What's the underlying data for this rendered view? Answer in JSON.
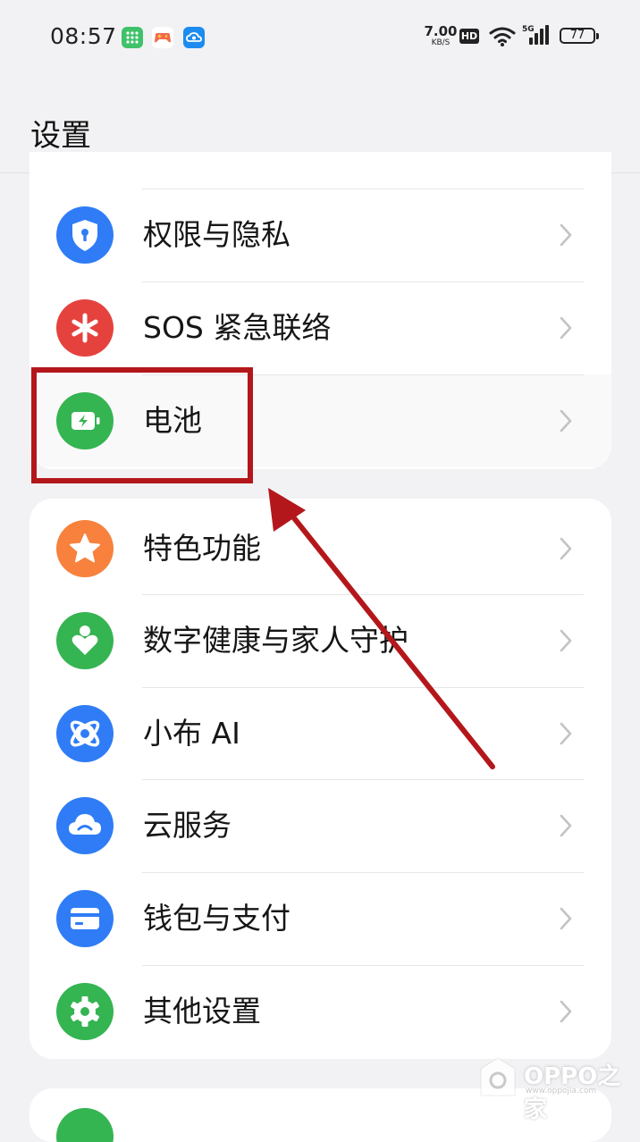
{
  "status_bar": {
    "time": "08:57",
    "net_speed_value": "7.00",
    "net_speed_unit": "KB/S",
    "hd_label": "HD",
    "network_type": "5G",
    "battery_level": "77",
    "app_icons": [
      "grid-app-icon",
      "game-controller-icon",
      "cloud-app-icon"
    ]
  },
  "header": {
    "title": "设置"
  },
  "groups": [
    {
      "items": [
        {
          "label": "权限与隐私",
          "icon": "shield-icon",
          "color": "#2f7cf6"
        },
        {
          "label": "SOS 紧急联络",
          "icon": "sos-asterisk-icon",
          "color": "#e5423e"
        },
        {
          "label": "电池",
          "icon": "battery-icon",
          "color": "#35b452"
        }
      ]
    },
    {
      "items": [
        {
          "label": "特色功能",
          "icon": "star-icon",
          "color": "#f7813d"
        },
        {
          "label": "数字健康与家人守护",
          "icon": "family-heart-icon",
          "color": "#35b452"
        },
        {
          "label": "小布 AI",
          "icon": "xiaobu-ai-icon",
          "color": "#2f7cf6"
        },
        {
          "label": "云服务",
          "icon": "cloud-icon",
          "color": "#2f7cf6"
        },
        {
          "label": "钱包与支付",
          "icon": "wallet-icon",
          "color": "#2f7cf6"
        },
        {
          "label": "其他设置",
          "icon": "gear-icon",
          "color": "#35b452"
        }
      ]
    }
  ],
  "annotation": {
    "highlight_color": "#b4171b",
    "highlighted_item": "电池"
  },
  "watermark": {
    "text": "OPPO之家",
    "url": "www.oppojia.com"
  }
}
